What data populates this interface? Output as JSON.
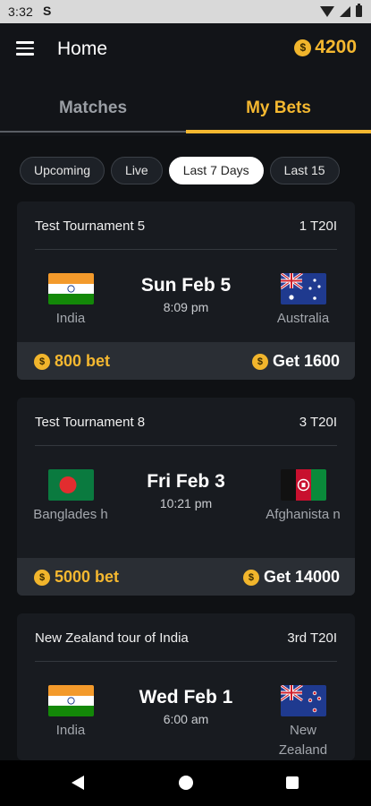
{
  "status_bar": {
    "time": "3:32",
    "notification_icon": "S"
  },
  "app_bar": {
    "title": "Home",
    "balance": "4200",
    "coin_symbol": "$"
  },
  "tabs": [
    {
      "label": "Matches",
      "active": false
    },
    {
      "label": "My Bets",
      "active": true
    }
  ],
  "filters": [
    {
      "label": "Upcoming",
      "active": false
    },
    {
      "label": "Live",
      "active": false
    },
    {
      "label": "Last 7 Days",
      "active": true
    },
    {
      "label": "Last 15",
      "active": false
    }
  ],
  "bets": [
    {
      "tournament": "Test Tournament 5",
      "format": "1 T20I",
      "team1": {
        "name": "India",
        "flag": "india"
      },
      "team2": {
        "name": "Australia",
        "flag": "australia"
      },
      "date": "Sun Feb 5",
      "time": "8:09 pm",
      "bet": "800 bet",
      "payout": "Get 1600"
    },
    {
      "tournament": "Test Tournament 8",
      "format": "3 T20I",
      "team1": {
        "name": "Banglades h",
        "flag": "bangladesh"
      },
      "team2": {
        "name": "Afghanista n",
        "flag": "afghanistan"
      },
      "date": "Fri Feb 3",
      "time": "10:21 pm",
      "bet": "5000 bet",
      "payout": "Get 14000"
    },
    {
      "tournament": "New Zealand tour of India",
      "format": "3rd T20I",
      "team1": {
        "name": "India",
        "flag": "india"
      },
      "team2": {
        "name": "New Zealand",
        "flag": "new-zealand"
      },
      "date": "Wed Feb 1",
      "time": "6:00 am"
    }
  ],
  "colors": {
    "accent": "#f5b830",
    "background": "#0f1114",
    "card": "#181b20",
    "card_footer": "#2a2e34"
  }
}
